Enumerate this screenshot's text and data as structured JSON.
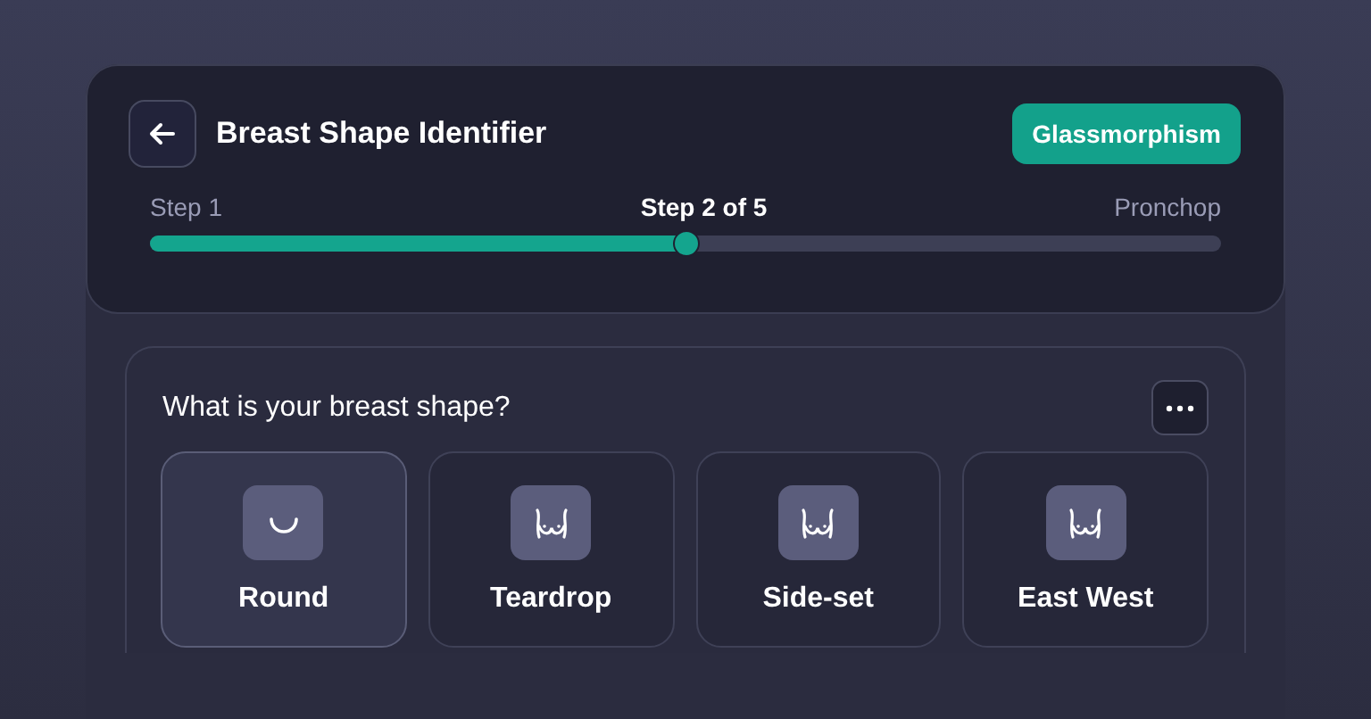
{
  "header": {
    "title": "Breast Shape Identifier",
    "badge": "Glassmorphism"
  },
  "progress": {
    "start_label": "Step 1",
    "current_label": "Step 2 of 5",
    "end_label": "Pronchop",
    "level": 0.5
  },
  "question": {
    "title": "What is your breast shape?",
    "options": [
      {
        "label": "Round",
        "kind": "round",
        "selected": true
      },
      {
        "label": "Teardrop",
        "kind": "torso",
        "selected": false
      },
      {
        "label": "Side-set",
        "kind": "torso",
        "selected": false
      },
      {
        "label": "East West",
        "kind": "torso",
        "selected": false
      }
    ]
  }
}
